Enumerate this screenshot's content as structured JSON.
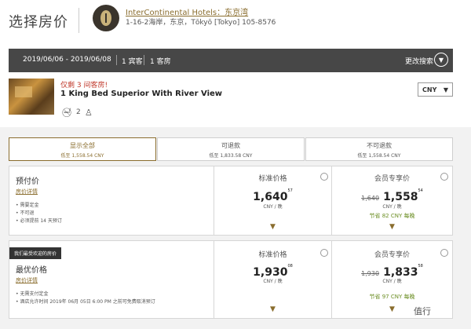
{
  "header": {
    "title": "选择房价",
    "hotel_name": "InterContinental Hotels：东京湾",
    "hotel_address": "1-16-2海岸，东京，Tōkyō [Tokyo] 105-8576"
  },
  "search_bar": {
    "dates": "2019/06/06 - 2019/06/08",
    "guests": "1 宾客",
    "rooms": "1 客房",
    "change_label": "更改搜索",
    "chevron": "chevron-down-icon"
  },
  "room": {
    "availability": "仅剩 3 间客房!",
    "name": "1 King Bed Superior With River View",
    "occupancy": "2",
    "currency": "CNY"
  },
  "filters": [
    {
      "label": "显示全部",
      "sub": "低至 1,558.54 CNY"
    },
    {
      "label": "可退款",
      "sub": "低至 1,833.58 CNY"
    },
    {
      "label": "不可退款",
      "sub": "低至 1,558.54 CNY"
    }
  ],
  "rates": [
    {
      "name": "预付价",
      "link": "房价详情",
      "bullets": [
        "需要定金",
        "不可退",
        "必须提前 14 天预订"
      ],
      "standard": {
        "title": "标准价格",
        "price": "1,640",
        "cents": "57",
        "unit": "CNY / 晚"
      },
      "member": {
        "title": "会员专享价",
        "old_price": "1,640",
        "price": "1,558",
        "cents": "54",
        "unit": "CNY / 晚",
        "save": "节省 82 CNY 每晚"
      }
    },
    {
      "badge": "我们最受欢迎的房价",
      "name": "最优价格",
      "link": "房价详情",
      "bullets": [
        "无需支付定金",
        "酒店允许时间 2019年 06月 05日 6:00 PM 之前可免费取消预订"
      ],
      "standard": {
        "title": "标准价格",
        "price": "1,930",
        "cents": "08",
        "unit": "CNY / 晚"
      },
      "member": {
        "title": "会员专享价",
        "old_price": "1,930",
        "price": "1,833",
        "cents": "58",
        "unit": "CNY / 晚",
        "save": "节省 97 CNY 每晚"
      }
    }
  ],
  "watermark": "值行"
}
